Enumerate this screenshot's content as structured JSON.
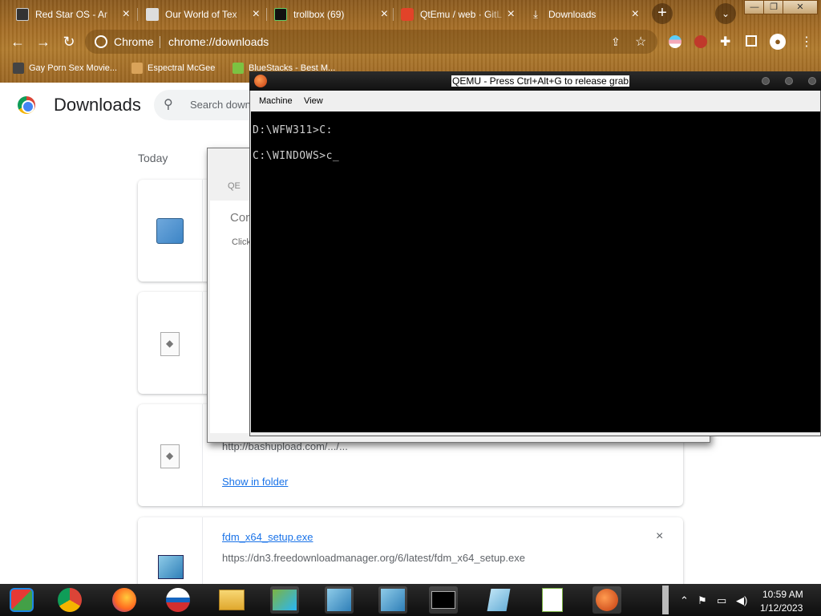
{
  "browser": {
    "tabs": [
      {
        "title": "Red Star OS - Ar",
        "icon": "monitor-icon"
      },
      {
        "title": "Our World of Tex",
        "icon": "page-icon"
      },
      {
        "title": "trollbox (69)",
        "icon": "terminal-icon"
      },
      {
        "title": "QtEmu / web · GitL",
        "icon": "gitlab-icon"
      },
      {
        "title": "Downloads",
        "icon": "download-icon"
      }
    ],
    "omnibox": {
      "site": "Chrome",
      "url": "chrome://downloads"
    },
    "bookmarks": [
      {
        "label": "Gay Porn Sex Movie..."
      },
      {
        "label": "Espectral McGee"
      },
      {
        "label": "BlueStacks - Best M..."
      }
    ]
  },
  "downloads": {
    "title": "Downloads",
    "search_placeholder": "Search downloads",
    "section": "Today",
    "items": [
      {
        "url": "http://bashupload.com/.../...",
        "action": "Show in folder"
      },
      {
        "name": "fdm_x64_setup.exe",
        "url": "https://dn3.freedownloadmanager.org/6/latest/fdm_x64_setup.exe",
        "close": "×"
      }
    ]
  },
  "dialog": {
    "tab": "QE",
    "heading": "Cor",
    "sub": "Click"
  },
  "qemu": {
    "title": "QEMU - Press Ctrl+Alt+G to release grab",
    "menu": [
      "Machine",
      "View"
    ],
    "terminal_lines": [
      "D:\\WFW311>C:",
      "C:\\WINDOWS>c_"
    ]
  },
  "taskbar": {
    "time": "10:59 AM",
    "date": "1/12/2023"
  },
  "colors": {
    "accent": "#1a73e8",
    "frame": "#a56d25"
  }
}
